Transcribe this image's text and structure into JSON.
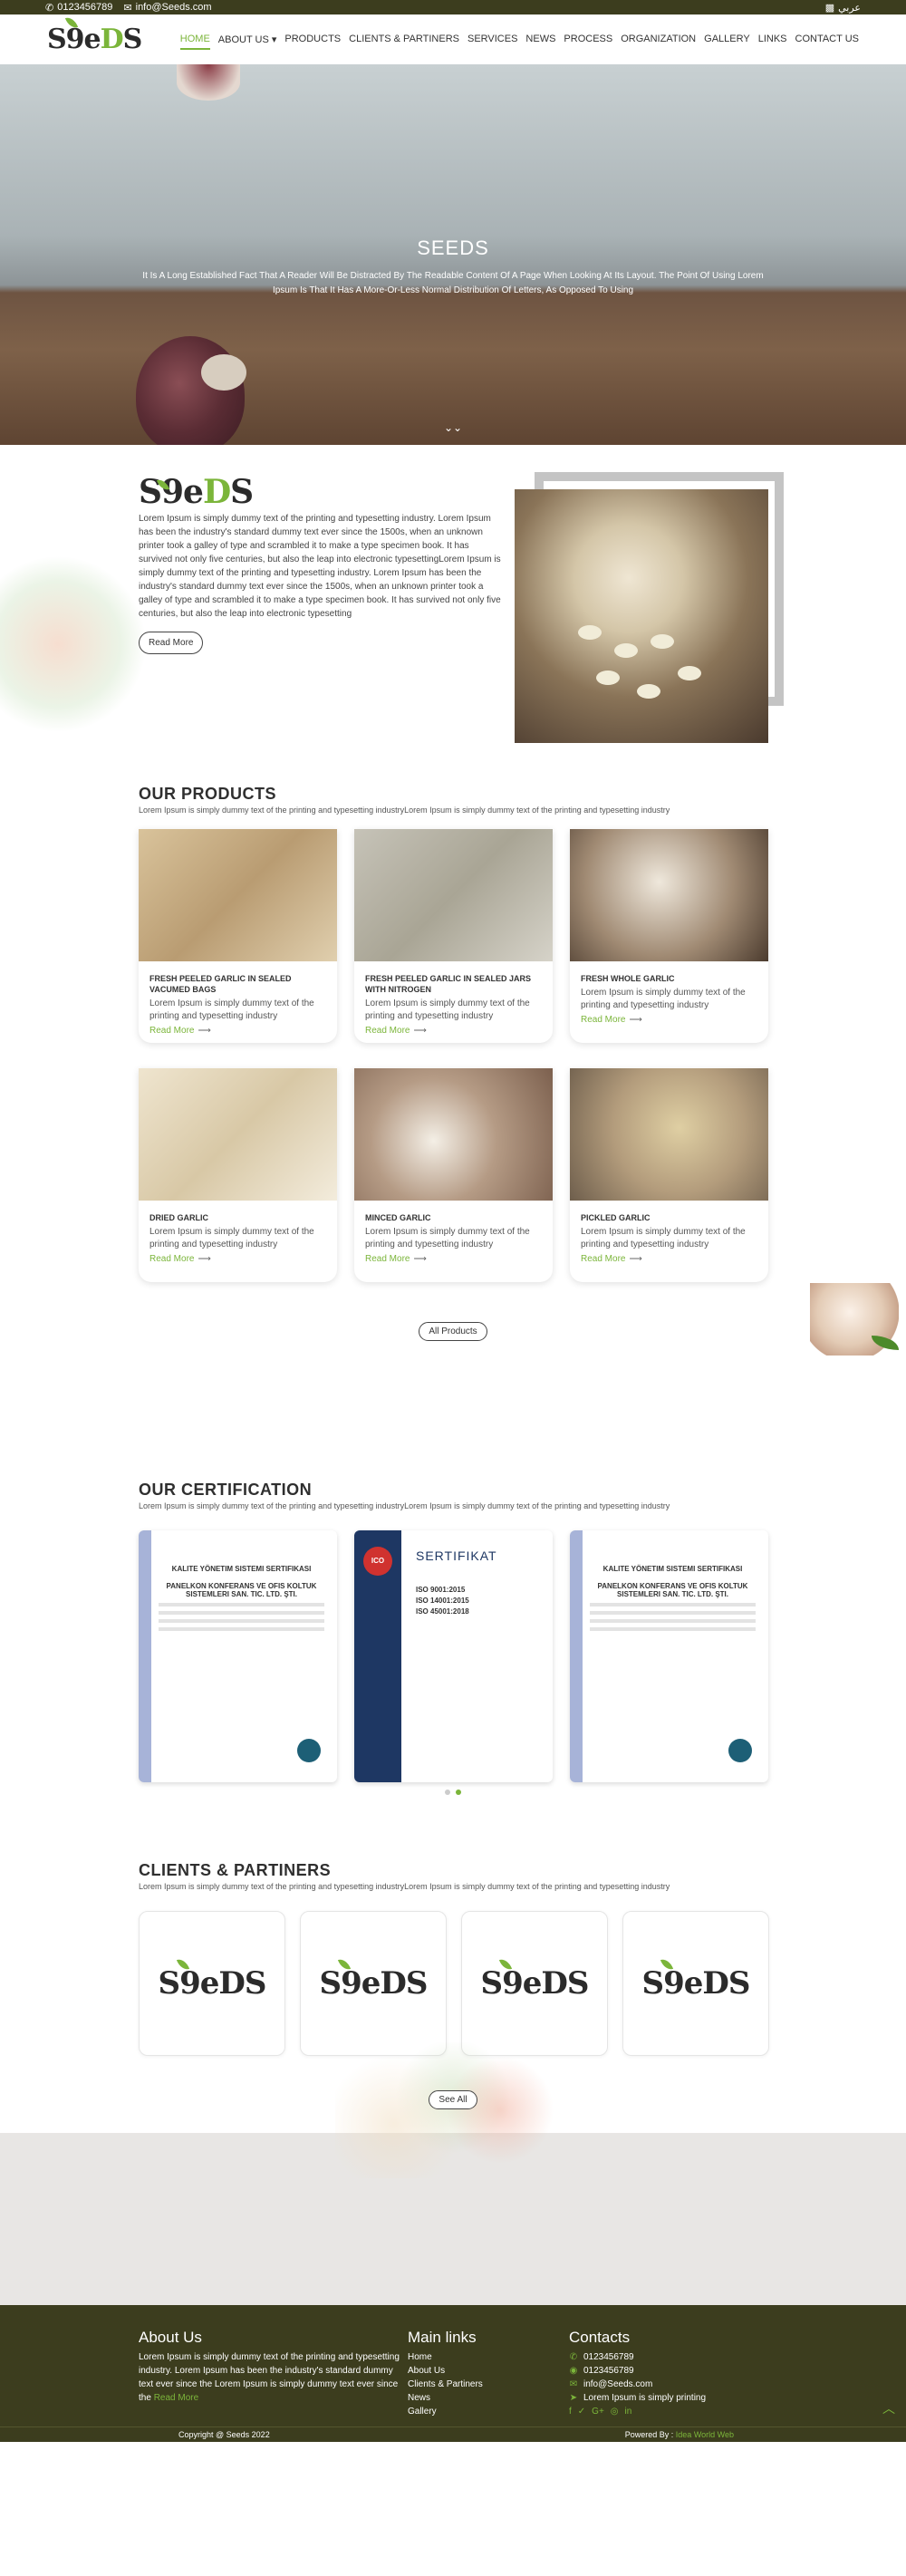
{
  "topbar": {
    "phone": "0123456789",
    "email": "info@Seeds.com",
    "language": "عربي"
  },
  "nav": {
    "logo_dark": "S9e",
    "logo_green": "D",
    "logo_tail": "S",
    "items": [
      {
        "label": "HOME"
      },
      {
        "label": "ABOUT US ▾"
      },
      {
        "label": "PRODUCTS"
      },
      {
        "label": "CLIENTS & PARTINERS"
      },
      {
        "label": "SERVICES"
      },
      {
        "label": "NEWS"
      },
      {
        "label": "PROCESS"
      },
      {
        "label": "ORGANIZATION"
      },
      {
        "label": "GALLERY"
      },
      {
        "label": "LINKS"
      },
      {
        "label": "CONTACT US"
      }
    ]
  },
  "hero": {
    "title": "SEEDS",
    "text": "It Is A Long Established Fact That A Reader Will Be Distracted By The Readable Content Of A Page When Looking At Its Layout. The Point Of Using Lorem Ipsum Is That It Has A More-Or-Less Normal Distribution Of Letters, As Opposed To Using"
  },
  "about": {
    "text": "Lorem Ipsum is simply dummy text of the printing and typesetting industry. Lorem Ipsum has been the industry's standard dummy text ever since the 1500s, when an unknown printer took a galley of type and scrambled it to make a type specimen book. It has survived not only five centuries, but also the leap into electronic typesettingLorem Ipsum is simply dummy text of the printing and typesetting industry. Lorem Ipsum has been the industry's standard dummy text ever since the 1500s, when an unknown printer took a galley of type and scrambled it to make a type specimen book. It has survived not only five centuries, but also the leap into electronic typesetting",
    "button": "Read More"
  },
  "products": {
    "title": "OUR PRODUCTS",
    "subtitle": "Lorem Ipsum is simply dummy text of the printing and typesetting industryLorem Ipsum is simply dummy text of the printing and typesetting industry",
    "items": [
      {
        "title": "FRESH PEELED GARLIC IN SEALED VACUMED BAGS",
        "desc": "Lorem Ipsum is simply dummy text of the printing and typesetting industry",
        "more": "Read More",
        "color": "#c9b38d"
      },
      {
        "title": "FRESH PEELED GARLIC IN SEALED JARS WITH NITROGEN",
        "desc": "Lorem Ipsum is simply dummy text of the printing and typesetting industry",
        "more": "Read More",
        "color": "#b6b2a6"
      },
      {
        "title": "FRESH WHOLE GARLIC",
        "desc": "Lorem Ipsum is simply dummy text of the printing and typesetting industry",
        "more": "Read More",
        "color": "#7d6b58"
      },
      {
        "title": "DRIED GARLIC",
        "desc": "Lorem Ipsum is simply dummy text of the printing and typesetting industry",
        "more": "Read More",
        "color": "#d9cfb8"
      },
      {
        "title": "MINCED GARLIC",
        "desc": "Lorem Ipsum is simply dummy text of the printing and typesetting industry",
        "more": "Read More",
        "color": "#9b7f69"
      },
      {
        "title": "PICKLED GARLIC",
        "desc": "Lorem Ipsum is simply dummy text of the printing and typesetting industry",
        "more": "Read More",
        "color": "#a49682"
      }
    ],
    "all_button": "All Products"
  },
  "certification": {
    "title": "OUR CERTIFICATION",
    "subtitle": "Lorem Ipsum is simply dummy text of the printing and typesetting industryLorem Ipsum is simply dummy text of the printing and typesetting industry",
    "cert_heading": "KALITE YÖNETIM SISTEMI SERTIFIKASI",
    "cert_company": "PANELKON KONFERANS VE OFIS KOLTUK SISTEMLERI SAN. TIC. LTD. ŞTI.",
    "cert2_title": "SERTIFIKAT",
    "cert2_logo": "ICO",
    "cert2_lines": [
      "ISO 9001:2015",
      "ISO 14001:2015",
      "ISO 45001:2018"
    ]
  },
  "clients": {
    "title": "CLIENTS & PARTINERS",
    "subtitle": "Lorem Ipsum is simply dummy text of the printing and typesetting industryLorem Ipsum is simply dummy text of the printing and typesetting industry",
    "button": "See All"
  },
  "footer": {
    "about_title": "About Us",
    "about_text": "Lorem Ipsum is simply dummy text of the printing and typesetting industry. Lorem Ipsum has been the industry's standard dummy text ever since the Lorem Ipsum is simply dummy text ever since the",
    "about_more": "Read More",
    "links_title": "Main links",
    "links": [
      "Home",
      "About Us",
      "Clients & Partiners",
      "News",
      "Gallery"
    ],
    "contacts_title": "Contacts",
    "phone1": "0123456789",
    "phone2": "0123456789",
    "email": "info@Seeds.com",
    "address": "Lorem Ipsum is simply printing",
    "socials": [
      "f",
      "✓",
      "G+",
      "◎",
      "in"
    ],
    "copyright": "Copyright @ Seeds 2022",
    "powered_prefix": "Powered By :",
    "powered_by": "Idea World Web"
  }
}
